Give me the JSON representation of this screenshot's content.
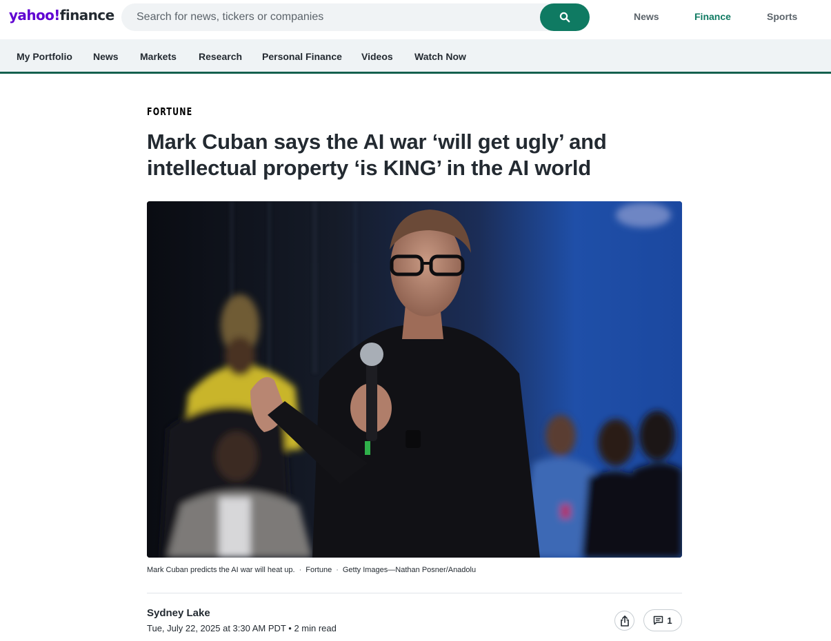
{
  "header": {
    "logo_primary": "yahoo!",
    "logo_secondary": "finance",
    "search_placeholder": "Search for news, tickers or companies",
    "search_icon": "search-icon",
    "links": [
      {
        "label": "News",
        "active": false
      },
      {
        "label": "Finance",
        "active": true
      },
      {
        "label": "Sports",
        "active": false
      }
    ]
  },
  "subnav": {
    "items": [
      "My Portfolio",
      "News",
      "Markets",
      "Research",
      "Personal Finance",
      "Videos",
      "Watch Now"
    ]
  },
  "article": {
    "publisher": "FORTUNE",
    "headline": "Mark Cuban says the AI war ‘will get ugly’ and intellectual property ‘is KING’ in the AI world",
    "image_icon": "photo-of-speaker-with-microphone",
    "caption": {
      "text": "Mark Cuban predicts the AI war will heat up.",
      "source": "Fortune",
      "credit": "Getty Images—Nathan Posner/Anadolu",
      "separator": "·"
    },
    "author": "Sydney Lake",
    "date": "Tue, July 22, 2025 at 3:30 AM PDT",
    "read_time": "2 min read",
    "meta_separator": "•",
    "share_icon": "share-icon",
    "comment_icon": "comment-icon",
    "comment_count": "1"
  },
  "colors": {
    "brand_purple": "#6001d2",
    "finance_green": "#0f7a62",
    "text_dark": "#232a31",
    "nav_bg": "#eff3f5"
  }
}
